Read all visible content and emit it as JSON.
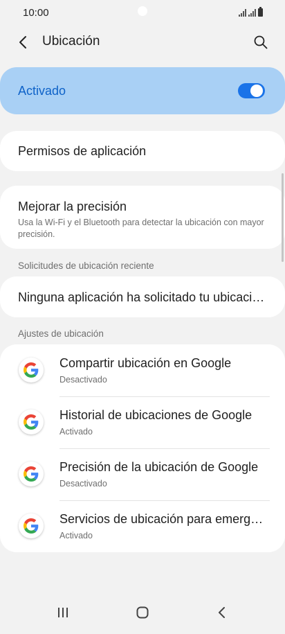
{
  "status_bar": {
    "time": "10:00"
  },
  "app_bar": {
    "title": "Ubicación",
    "back_icon": "chevron-left-icon",
    "search_icon": "search-icon"
  },
  "master_switch": {
    "label": "Activado",
    "state": "on",
    "accent_color": "#1a73e8",
    "background_color": "#a9d0f5"
  },
  "app_permissions": {
    "title": "Permisos de aplicación"
  },
  "accuracy": {
    "title": "Mejorar la precisión",
    "subtitle": "Usa la Wi-Fi y el Bluetooth para detectar la ubicación con mayor precisión."
  },
  "recent_requests": {
    "header": "Solicitudes de ubicación reciente",
    "text": "Ninguna aplicación ha solicitado tu ubicación recientemente"
  },
  "location_settings": {
    "header": "Ajustes de ubicación",
    "items": [
      {
        "title": "Compartir ubicación en Google",
        "status": "Desactivado",
        "icon": "google-icon"
      },
      {
        "title": "Historial de ubicaciones de Google",
        "status": "Activado",
        "icon": "google-icon"
      },
      {
        "title": "Precisión de la ubicación de Google",
        "status": "Desactivado",
        "icon": "google-icon"
      },
      {
        "title": "Servicios de ubicación para emergencias",
        "status": "Activado",
        "icon": "google-icon"
      }
    ]
  },
  "nav_bar": {
    "recents_icon": "recents-icon",
    "home_icon": "home-icon",
    "back_icon": "back-icon"
  }
}
